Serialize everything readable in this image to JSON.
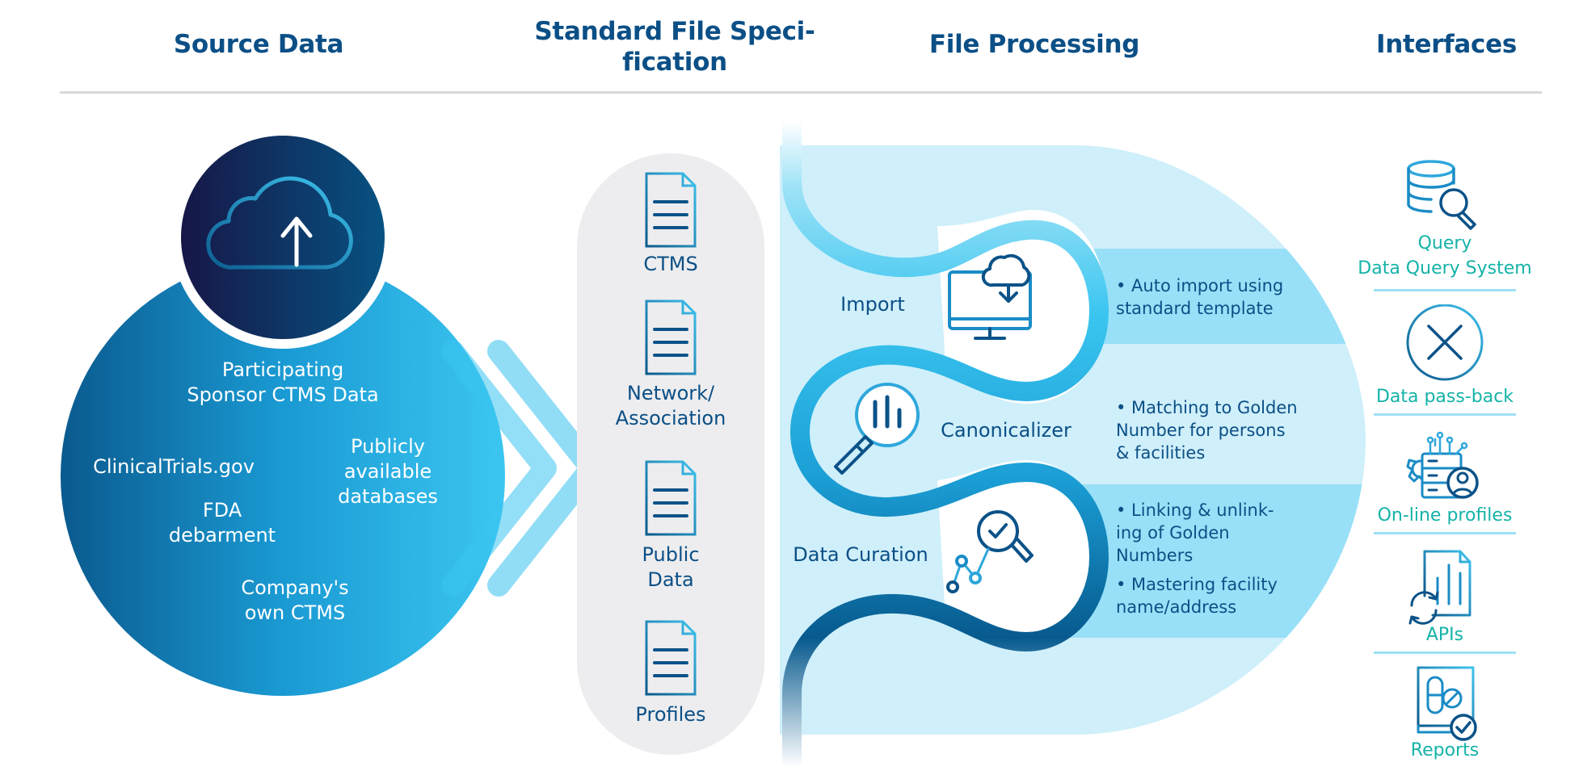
{
  "headers": {
    "source": "Source Data",
    "spec_line1": "Standard File Speci-",
    "spec_line2": "fication",
    "processing": "File Processing",
    "interfaces": "Interfaces"
  },
  "source_data": {
    "icon": "cloud-upload-icon",
    "items": [
      {
        "line1": "Participating",
        "line2": "Sponsor CTMS Data"
      },
      {
        "line1": "ClinicalTrials.gov",
        "line2": ""
      },
      {
        "line1": "Publicly",
        "line2": "available",
        "line3": "databases"
      },
      {
        "line1": "FDA",
        "line2": "debarment"
      },
      {
        "line1": "Company's",
        "line2": "own CTMS"
      }
    ]
  },
  "spec_files": [
    {
      "icon": "document-icon",
      "line1": "CTMS",
      "line2": ""
    },
    {
      "icon": "document-icon",
      "line1": "Network/",
      "line2": "Association"
    },
    {
      "icon": "document-icon",
      "line1": "Public",
      "line2": "Data"
    },
    {
      "icon": "document-icon",
      "line1": "Profiles",
      "line2": ""
    }
  ],
  "processing": {
    "steps": [
      {
        "label": "Import",
        "icon": "monitor-cloud-download-icon",
        "bullets": [
          {
            "line1": "• Auto import using",
            "line2": "standard template"
          }
        ]
      },
      {
        "label": "Canonicalizer",
        "icon": "magnifier-chart-icon",
        "bullets": [
          {
            "line1": "• Matching to Golden",
            "line2": "Number for persons",
            "line3": "& facilities"
          }
        ]
      },
      {
        "label": "Data Curation",
        "icon": "magnifier-check-graph-icon",
        "bullets": [
          {
            "line1": "• Linking & unlink-",
            "line2": "ing of Golden",
            "line3": "Numbers"
          },
          {
            "line1": "• Mastering facility",
            "line2": "name/address"
          }
        ]
      }
    ]
  },
  "interfaces": [
    {
      "icon": "database-search-icon",
      "line1": "Query",
      "line2": "Data Query System"
    },
    {
      "icon": "circle-x-icon",
      "line1": "Data pass-back",
      "line2": ""
    },
    {
      "icon": "server-user-gear-icon",
      "line1": "On-line profiles",
      "line2": ""
    },
    {
      "icon": "document-chart-sync-icon",
      "line1": "APIs",
      "line2": ""
    },
    {
      "icon": "report-pills-check-icon",
      "line1": "Reports",
      "line2": ""
    }
  ],
  "colors": {
    "navy": "#0b4f86",
    "dark_navy": "#15194a",
    "cyan": "#3ac5f0",
    "light_cyan": "#cfeffa",
    "band_cyan": "#98e0f7",
    "teal_text": "#14b3a8",
    "gray_pill": "#ededef"
  }
}
